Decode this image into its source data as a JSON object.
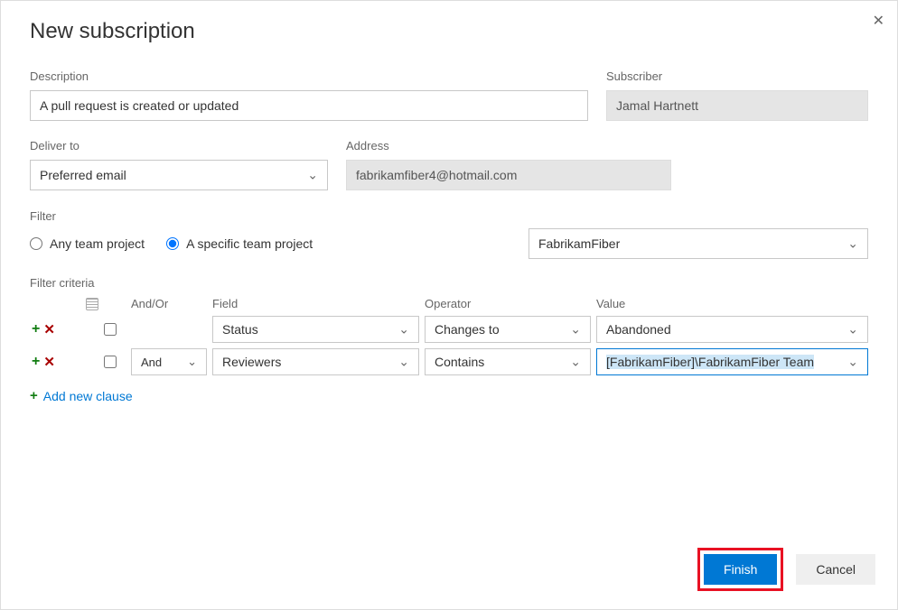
{
  "title": "New subscription",
  "labels": {
    "description": "Description",
    "subscriber": "Subscriber",
    "deliverTo": "Deliver to",
    "address": "Address",
    "filter": "Filter",
    "filterCriteria": "Filter criteria"
  },
  "fields": {
    "description": "A pull request is created or updated",
    "subscriber": "Jamal Hartnett",
    "deliverTo": "Preferred email",
    "address": "fabrikamfiber4@hotmail.com"
  },
  "filter": {
    "anyLabel": "Any team project",
    "specificLabel": "A specific team project",
    "selected": "specific",
    "project": "FabrikamFiber"
  },
  "criteria": {
    "headers": {
      "andor": "And/Or",
      "field": "Field",
      "operator": "Operator",
      "value": "Value"
    },
    "rows": [
      {
        "andor": "",
        "field": "Status",
        "operator": "Changes to",
        "value": "Abandoned"
      },
      {
        "andor": "And",
        "field": "Reviewers",
        "operator": "Contains",
        "value": "[FabrikamFiber]\\FabrikamFiber Team"
      }
    ],
    "addNew": "Add new clause"
  },
  "buttons": {
    "finish": "Finish",
    "cancel": "Cancel"
  }
}
